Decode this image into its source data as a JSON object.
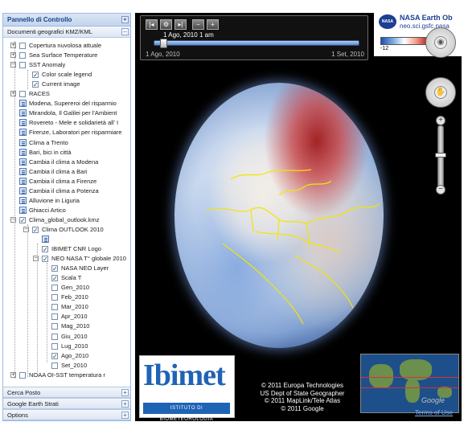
{
  "sidebar": {
    "title": "Pannello di Controllo",
    "section_title": "Documenti geografici KMZ/KML",
    "tree": [
      {
        "label": "Copertura nuvolosa attuale",
        "checked": false,
        "kind": "folder",
        "level": 0
      },
      {
        "label": "Sea Surface Temperature",
        "checked": false,
        "kind": "folder",
        "level": 0
      },
      {
        "label": "SST Anomaly",
        "checked": false,
        "kind": "folder-open",
        "level": 0
      },
      {
        "label": "Color scale legend",
        "checked": true,
        "kind": "item",
        "level": 1
      },
      {
        "label": "Current image",
        "checked": true,
        "kind": "item",
        "level": 1
      },
      {
        "label": "RACES",
        "checked": false,
        "kind": "folder",
        "level": 0
      },
      {
        "label": "Modena, Supereroi del risparmio",
        "kind": "doc",
        "level": 0
      },
      {
        "label": "Mirandola, Il Galilei per l'Ambient",
        "kind": "doc",
        "level": 0
      },
      {
        "label": "Rovereto - Mele e solidarietà all' I",
        "kind": "doc",
        "level": 0
      },
      {
        "label": "Firenze, Laboratori per risparmiare",
        "kind": "doc",
        "level": 0
      },
      {
        "label": "Clima a Trento",
        "kind": "doc",
        "level": 0
      },
      {
        "label": "Bari, bici in città",
        "kind": "doc",
        "level": 0
      },
      {
        "label": "Cambia il clima a Modena",
        "kind": "doc",
        "level": 0
      },
      {
        "label": "Cambia il clima a Bari",
        "kind": "doc",
        "level": 0
      },
      {
        "label": "Cambia il clima a Firenze",
        "kind": "doc",
        "level": 0
      },
      {
        "label": "Cambia il clima a Potenza",
        "kind": "doc",
        "level": 0
      },
      {
        "label": "Alluvione in Liguria",
        "kind": "doc",
        "level": 0
      },
      {
        "label": "Ghiacci Artico",
        "kind": "doc",
        "level": 0
      },
      {
        "label": "Clima_global_outlook.kmz",
        "checked": true,
        "kind": "folder-open",
        "level": 0
      },
      {
        "label": "Clima OUTLOOK 2010",
        "checked": true,
        "kind": "folder-open",
        "level": 1
      },
      {
        "label": "",
        "kind": "doc",
        "level": 2
      },
      {
        "label": "IBIMET CNR Logo",
        "checked": true,
        "kind": "item",
        "level": 2
      },
      {
        "label": "NEO NASA T° globale 2010",
        "checked": true,
        "kind": "folder-open",
        "level": 2
      },
      {
        "label": "NASA NEO Layer",
        "checked": true,
        "kind": "item",
        "level": 3
      },
      {
        "label": "Scala T",
        "checked": true,
        "kind": "item",
        "level": 3
      },
      {
        "label": "Gen_2010",
        "checked": false,
        "kind": "item",
        "level": 3
      },
      {
        "label": "Feb_2010",
        "checked": false,
        "kind": "item",
        "level": 3
      },
      {
        "label": "Mar_2010",
        "checked": false,
        "kind": "item",
        "level": 3
      },
      {
        "label": "Apr_2010",
        "checked": false,
        "kind": "item",
        "level": 3
      },
      {
        "label": "Mag_2010",
        "checked": false,
        "kind": "item",
        "level": 3
      },
      {
        "label": "Giu_2010",
        "checked": false,
        "kind": "item",
        "level": 3
      },
      {
        "label": "Lug_2010",
        "checked": false,
        "kind": "item",
        "level": 3
      },
      {
        "label": "Ago_2010",
        "checked": true,
        "kind": "item",
        "level": 3
      },
      {
        "label": "Set_2010",
        "checked": false,
        "kind": "item",
        "level": 3
      },
      {
        "label": "NOAA OI-SST temperatura r",
        "checked": false,
        "kind": "folder",
        "level": 0
      }
    ],
    "bottom_sections": [
      "Cerca Posto",
      "Google Earth Strati",
      "Options"
    ]
  },
  "time_control": {
    "current": "1 Ago, 2010",
    "current_time": "1 am",
    "start": "1 Ago, 2010",
    "end": "1 Set, 2010",
    "position": 0.03
  },
  "legend": {
    "title_line1": "NASA Earth Ob",
    "title_line2": "neo.sci.gsfc.nasa",
    "logo_text": "NASA",
    "min": "-12",
    "max": ""
  },
  "logo": {
    "name": "Ibimet",
    "subtitle": "ISTITUTO DI BIOMETEOROLOGIA"
  },
  "credits": [
    "© 2011 Europa Technologies",
    "US Dept of State Geographer",
    "© 2011 MapLink/Tele Atlas",
    "© 2011 Google"
  ],
  "footer": {
    "google": "Google",
    "terms": "Terms of Use"
  },
  "colors": {
    "panel_border": "#99bbe8",
    "panel_title": "#15428b",
    "anomaly_hot": "#b52020",
    "anomaly_cold": "#1f4fb0"
  }
}
